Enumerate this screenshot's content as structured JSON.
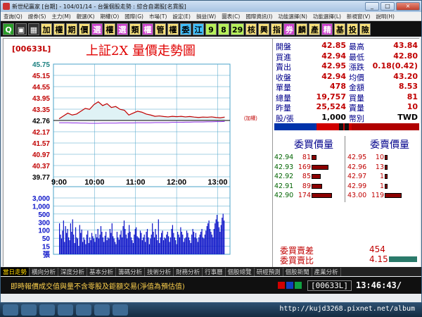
{
  "window": {
    "title": "新世紀贏家 [台期] - 104/01/14 - 台盤個股走勢 : 綜合自選股[名貫股]",
    "buttons": [
      "_",
      "□",
      "×"
    ]
  },
  "menu": [
    "查詢(Q)",
    "證券(S)",
    "主力(M)",
    "觀選(K)",
    "期權(O)",
    "國際(G)",
    "市場(T)",
    "設定(E)",
    "損益(W)",
    "圖表(C)",
    "國際資訊(I)",
    "功能選擇(N)",
    "功能選擇(L)",
    "新視窗(V)",
    "說明(H)"
  ],
  "toolbar": [
    {
      "label": "Q",
      "bg": "#2a9d2a",
      "fg": "#ffffff"
    },
    {
      "label": "▣",
      "bg": "#303030",
      "fg": "#ffffff"
    },
    {
      "label": "▦",
      "bg": "#303030",
      "fg": "#ffffff"
    },
    {
      "label": "加",
      "bg": "#f7e07a",
      "fg": "#000000"
    },
    {
      "label": "權",
      "bg": "#f7e07a",
      "fg": "#000000"
    },
    {
      "label": "期",
      "bg": "#f7e07a",
      "fg": "#000000"
    },
    {
      "label": "價",
      "bg": "#f7e07a",
      "fg": "#000000"
    },
    {
      "label": "選",
      "bg": "#cc44cc",
      "fg": "#ffffff"
    },
    {
      "label": "權",
      "bg": "#f7e07a",
      "fg": "#000000"
    },
    {
      "label": "選",
      "bg": "#cc44cc",
      "fg": "#ffffff"
    },
    {
      "label": "類",
      "bg": "#f7e07a",
      "fg": "#000000"
    },
    {
      "label": "權",
      "bg": "#cc44cc",
      "fg": "#ffffff"
    },
    {
      "label": "管",
      "bg": "#f7e07a",
      "fg": "#000000"
    },
    {
      "label": "權",
      "bg": "#f7e07a",
      "fg": "#000000"
    },
    {
      "label": "委",
      "bg": "#40c0ff",
      "fg": "#000000"
    },
    {
      "label": "江",
      "bg": "#40c0ff",
      "fg": "#000000"
    },
    {
      "label": "9",
      "bg": "#b6f05a",
      "fg": "#000000"
    },
    {
      "label": "8",
      "bg": "#b6f05a",
      "fg": "#000000"
    },
    {
      "label": "29",
      "bg": "#b6f05a",
      "fg": "#000000"
    },
    {
      "label": "核",
      "bg": "#f7e07a",
      "fg": "#000000"
    },
    {
      "label": "興",
      "bg": "#f7e07a",
      "fg": "#000000"
    },
    {
      "label": "指",
      "bg": "#f7e07a",
      "fg": "#000000"
    },
    {
      "label": "券",
      "bg": "#cc44cc",
      "fg": "#ffffff"
    },
    {
      "label": "麟",
      "bg": "#f7e07a",
      "fg": "#000000"
    },
    {
      "label": "產",
      "bg": "#f7e07a",
      "fg": "#000000"
    },
    {
      "label": "精",
      "bg": "#cc44cc",
      "fg": "#ffffff"
    },
    {
      "label": "基",
      "bg": "#f7e07a",
      "fg": "#000000"
    },
    {
      "label": "投",
      "bg": "#f7e07a",
      "fg": "#000000"
    },
    {
      "label": "險",
      "bg": "#f7e07a",
      "fg": "#000000"
    }
  ],
  "chart": {
    "code": "[00633L]",
    "title": "上証2X  量價走勢圖",
    "ref_label": "(加權)"
  },
  "chart_data": {
    "type": "line",
    "price_ticks": [
      "45.75",
      "45.15",
      "44.55",
      "43.95",
      "43.35",
      "42.76",
      "42.17",
      "41.57",
      "40.97",
      "40.37",
      "39.77"
    ],
    "price_ylim": [
      39.77,
      45.75
    ],
    "reference_price": 42.76,
    "volume_ticks": [
      "3,000",
      "1,000",
      "500",
      "300",
      "100",
      "50",
      "15",
      "張"
    ],
    "time_ticks": [
      "9:00",
      "10:00",
      "11:00",
      "12:00",
      "13:00"
    ],
    "price_series": [
      42.85,
      43.0,
      43.15,
      43.05,
      43.1,
      43.25,
      43.4,
      43.35,
      43.6,
      43.75,
      43.55,
      43.65,
      43.45,
      43.5,
      43.35,
      43.3,
      43.05,
      43.15,
      43.25,
      43.2,
      43.1,
      43.05,
      42.98,
      43.0,
      42.97,
      42.95,
      42.98,
      42.96,
      42.98,
      42.95,
      42.97,
      42.94,
      42.92,
      42.94,
      42.93,
      42.95,
      42.92,
      42.9,
      42.94
    ],
    "avg_series": [
      42.64,
      42.64,
      42.64,
      42.63,
      42.63,
      42.62,
      42.62,
      42.61,
      42.61,
      42.61,
      42.62,
      42.62,
      42.62,
      42.62,
      42.63,
      42.63,
      42.63,
      42.63,
      42.64,
      42.64,
      42.64,
      42.64,
      42.65,
      42.65,
      42.65,
      42.65,
      42.66,
      42.66,
      42.66,
      42.67,
      42.67,
      42.68,
      42.68,
      42.68,
      42.69,
      42.69,
      42.7,
      42.7,
      42.71
    ],
    "volume_series": [
      0.55,
      0.35,
      0.28,
      0.42,
      0.6,
      0.22,
      0.5,
      0.38,
      0.45,
      0.3,
      0.25,
      0.55,
      0.4,
      0.62,
      0.35,
      0.2,
      0.48,
      0.3,
      0.28,
      0.15,
      0.52,
      0.38,
      0.44,
      0.22,
      0.3,
      0.26,
      0.18,
      0.35,
      0.42,
      0.2,
      0.3,
      0.25,
      0.38,
      0.32,
      0.28,
      0.22,
      0.36,
      0.3,
      0.45,
      0.28,
      0.35,
      0.5,
      0.4,
      0.3,
      0.22,
      0.33,
      0.4,
      0.25,
      0.3,
      0.28,
      0.45,
      0.38,
      0.55,
      0.32,
      0.28,
      0.22,
      0.18,
      0.4,
      0.3,
      0.26,
      0.35,
      0.42,
      0.3,
      0.5,
      0.6,
      0.45,
      0.35,
      0.28,
      0.38,
      0.52,
      0.4,
      0.3,
      0.25,
      0.2,
      0.35,
      0.45,
      0.48,
      0.32,
      0.3,
      0.28,
      0.42,
      0.38,
      0.25,
      0.3,
      0.35,
      0.22,
      0.4,
      0.45,
      0.3,
      0.18,
      0.28,
      0.35,
      0.55,
      0.4,
      0.3,
      0.45,
      0.35,
      0.25,
      0.62,
      0.2,
      0.3,
      0.38,
      0.42,
      0.25,
      0.3,
      0.28,
      0.35,
      0.4,
      0.32,
      0.22,
      0.3,
      0.45,
      0.52,
      0.38,
      0.3,
      0.25,
      0.18,
      0.4,
      0.35,
      0.3,
      0.48,
      0.4,
      0.35,
      0.22,
      0.28,
      0.3,
      0.42,
      0.38,
      0.3,
      0.25,
      0.2,
      0.35,
      0.45,
      0.4,
      0.3,
      0.38,
      0.28,
      0.22,
      0.3,
      0.35,
      0.4,
      0.45,
      0.3,
      0.28,
      0.35,
      0.42,
      0.5,
      0.55,
      0.6,
      0.45,
      0.4,
      0.35,
      0.3,
      0.45,
      0.55,
      0.62,
      0.7,
      0.58,
      0.48,
      0.4,
      0.52,
      0.65,
      0.72,
      0.6
    ],
    "colors": {
      "price": "#c00000",
      "avg": "#8a2be2",
      "area": "#dff2f5",
      "volume": "#0a12c8",
      "ref": "#000000",
      "grid": "#4aa3c8"
    }
  },
  "quote": {
    "left": [
      {
        "label": "開盤",
        "value": "42.85",
        "color": "#c00000"
      },
      {
        "label": "買進",
        "value": "42.94",
        "color": "#c00000"
      },
      {
        "label": "賣出",
        "value": "42.95",
        "color": "#c00000"
      },
      {
        "label": "收盤",
        "value": "42.94",
        "color": "#c00000"
      },
      {
        "label": "單量",
        "value": "478",
        "color": "#c00000"
      },
      {
        "label": "總量",
        "value": "19,757",
        "color": "#c00000"
      },
      {
        "label": "昨量",
        "value": "25,524",
        "color": "#c00000"
      },
      {
        "label": "股/張",
        "value": "1,000",
        "color": "#000000"
      }
    ],
    "right": [
      {
        "label": "最高",
        "value": "43.84",
        "color": "#c00000"
      },
      {
        "label": "最低",
        "value": "42.80",
        "color": "#c00000"
      },
      {
        "label": "漲跌",
        "value": "0.18(0.42)",
        "color": "#c00000"
      },
      {
        "label": "均價",
        "value": "43.20",
        "color": "#c00000"
      },
      {
        "label": "金額",
        "value": "8.53",
        "color": "#c00000"
      },
      {
        "label": "買量",
        "value": "81",
        "color": "#c00000"
      },
      {
        "label": "賣量",
        "value": "10",
        "color": "#c00000"
      },
      {
        "label": "幣別",
        "value": "TWD",
        "color": "#000000"
      }
    ]
  },
  "orderbook": {
    "bid_header": "委買價量",
    "ask_header": "委賣價量",
    "bids": [
      {
        "price": "42.94",
        "qty": "81",
        "fill": 0.15
      },
      {
        "price": "42.93",
        "qty": "169",
        "fill": 0.55
      },
      {
        "price": "42.92",
        "qty": "85",
        "fill": 0.3
      },
      {
        "price": "42.91",
        "qty": "89",
        "fill": 0.35
      },
      {
        "price": "42.90",
        "qty": "174",
        "fill": 0.65
      }
    ],
    "asks": [
      {
        "price": "42.95",
        "qty": "10",
        "fill": 0.08
      },
      {
        "price": "42.96",
        "qty": "13",
        "fill": 0.1
      },
      {
        "price": "42.97",
        "qty": "1",
        "fill": 0.03
      },
      {
        "price": "42.99",
        "qty": "1",
        "fill": 0.03
      },
      {
        "price": "43.00",
        "qty": "119",
        "fill": 0.55
      }
    ]
  },
  "bottom_quote": [
    {
      "label": "委買賣差",
      "value": "454"
    },
    {
      "label": "委買賣比",
      "value": "4.15"
    }
  ],
  "tabs": [
    "當日走勢",
    "橫向分析",
    "深度分析",
    "基本分析",
    "籌碼分析",
    "技術分析",
    "財務分析",
    "行事曆",
    "個股總覽",
    "研經預測",
    "個股新聞",
    "產業分析"
  ],
  "status": {
    "text": "即時報價成交值與量不含零股及鉅額交易(淨值為預估值)",
    "code": "[00633L]",
    "time": "13:46:43/"
  },
  "watermark": "http://kujd3268.pixnet.net/album"
}
